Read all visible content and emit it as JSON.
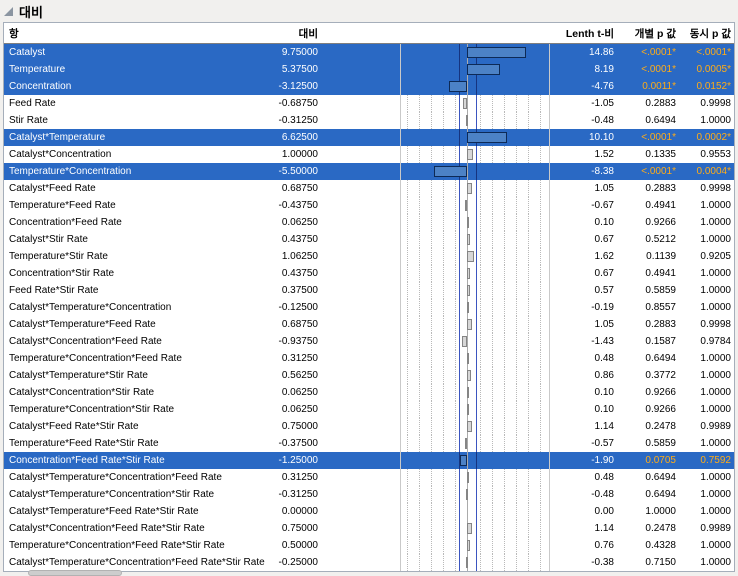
{
  "report": {
    "title": "대비"
  },
  "table": {
    "headers": {
      "term": "항",
      "contrast": "대비",
      "lenth_t": "Lenth t-비",
      "individual_p": "개별 p 값",
      "simultaneous_p": "동시 p 값"
    },
    "rows": [
      {
        "term": "Catalyst",
        "contrast": "9.75000",
        "lenth_t": "14.86",
        "p_individual": "<.0001*",
        "p_simultaneous": "<.0001*",
        "selected": true
      },
      {
        "term": "Temperature",
        "contrast": "5.37500",
        "lenth_t": "8.19",
        "p_individual": "<.0001*",
        "p_simultaneous": "0.0005*",
        "selected": true
      },
      {
        "term": "Concentration",
        "contrast": "-3.12500",
        "lenth_t": "-4.76",
        "p_individual": "0.0011*",
        "p_simultaneous": "0.0152*",
        "selected": true
      },
      {
        "term": "Feed Rate",
        "contrast": "-0.68750",
        "lenth_t": "-1.05",
        "p_individual": "0.2883",
        "p_simultaneous": "0.9998",
        "selected": false
      },
      {
        "term": "Stir Rate",
        "contrast": "-0.31250",
        "lenth_t": "-0.48",
        "p_individual": "0.6494",
        "p_simultaneous": "1.0000",
        "selected": false
      },
      {
        "term": "Catalyst*Temperature",
        "contrast": "6.62500",
        "lenth_t": "10.10",
        "p_individual": "<.0001*",
        "p_simultaneous": "0.0002*",
        "selected": true
      },
      {
        "term": "Catalyst*Concentration",
        "contrast": "1.00000",
        "lenth_t": "1.52",
        "p_individual": "0.1335",
        "p_simultaneous": "0.9553",
        "selected": false
      },
      {
        "term": "Temperature*Concentration",
        "contrast": "-5.50000",
        "lenth_t": "-8.38",
        "p_individual": "<.0001*",
        "p_simultaneous": "0.0004*",
        "selected": true
      },
      {
        "term": "Catalyst*Feed Rate",
        "contrast": "0.68750",
        "lenth_t": "1.05",
        "p_individual": "0.2883",
        "p_simultaneous": "0.9998",
        "selected": false
      },
      {
        "term": "Temperature*Feed Rate",
        "contrast": "-0.43750",
        "lenth_t": "-0.67",
        "p_individual": "0.4941",
        "p_simultaneous": "1.0000",
        "selected": false
      },
      {
        "term": "Concentration*Feed Rate",
        "contrast": "0.06250",
        "lenth_t": "0.10",
        "p_individual": "0.9266",
        "p_simultaneous": "1.0000",
        "selected": false
      },
      {
        "term": "Catalyst*Stir Rate",
        "contrast": "0.43750",
        "lenth_t": "0.67",
        "p_individual": "0.5212",
        "p_simultaneous": "1.0000",
        "selected": false
      },
      {
        "term": "Temperature*Stir Rate",
        "contrast": "1.06250",
        "lenth_t": "1.62",
        "p_individual": "0.1139",
        "p_simultaneous": "0.9205",
        "selected": false
      },
      {
        "term": "Concentration*Stir Rate",
        "contrast": "0.43750",
        "lenth_t": "0.67",
        "p_individual": "0.4941",
        "p_simultaneous": "1.0000",
        "selected": false
      },
      {
        "term": "Feed Rate*Stir Rate",
        "contrast": "0.37500",
        "lenth_t": "0.57",
        "p_individual": "0.5859",
        "p_simultaneous": "1.0000",
        "selected": false
      },
      {
        "term": "Catalyst*Temperature*Concentration",
        "contrast": "-0.12500",
        "lenth_t": "-0.19",
        "p_individual": "0.8557",
        "p_simultaneous": "1.0000",
        "selected": false
      },
      {
        "term": "Catalyst*Temperature*Feed Rate",
        "contrast": "0.68750",
        "lenth_t": "1.05",
        "p_individual": "0.2883",
        "p_simultaneous": "0.9998",
        "selected": false
      },
      {
        "term": "Catalyst*Concentration*Feed Rate",
        "contrast": "-0.93750",
        "lenth_t": "-1.43",
        "p_individual": "0.1587",
        "p_simultaneous": "0.9784",
        "selected": false
      },
      {
        "term": "Temperature*Concentration*Feed Rate",
        "contrast": "0.31250",
        "lenth_t": "0.48",
        "p_individual": "0.6494",
        "p_simultaneous": "1.0000",
        "selected": false
      },
      {
        "term": "Catalyst*Temperature*Stir Rate",
        "contrast": "0.56250",
        "lenth_t": "0.86",
        "p_individual": "0.3772",
        "p_simultaneous": "1.0000",
        "selected": false
      },
      {
        "term": "Catalyst*Concentration*Stir Rate",
        "contrast": "0.06250",
        "lenth_t": "0.10",
        "p_individual": "0.9266",
        "p_simultaneous": "1.0000",
        "selected": false
      },
      {
        "term": "Temperature*Concentration*Stir Rate",
        "contrast": "0.06250",
        "lenth_t": "0.10",
        "p_individual": "0.9266",
        "p_simultaneous": "1.0000",
        "selected": false
      },
      {
        "term": "Catalyst*Feed Rate*Stir Rate",
        "contrast": "0.75000",
        "lenth_t": "1.14",
        "p_individual": "0.2478",
        "p_simultaneous": "0.9989",
        "selected": false
      },
      {
        "term": "Temperature*Feed Rate*Stir Rate",
        "contrast": "-0.37500",
        "lenth_t": "-0.57",
        "p_individual": "0.5859",
        "p_simultaneous": "1.0000",
        "selected": false
      },
      {
        "term": "Concentration*Feed Rate*Stir Rate",
        "contrast": "-1.25000",
        "lenth_t": "-1.90",
        "p_individual": "0.0705",
        "p_simultaneous": "0.7592",
        "selected": true
      },
      {
        "term": "Catalyst*Temperature*Concentration*Feed Rate",
        "contrast": "0.31250",
        "lenth_t": "0.48",
        "p_individual": "0.6494",
        "p_simultaneous": "1.0000",
        "selected": false
      },
      {
        "term": "Catalyst*Temperature*Concentration*Stir Rate",
        "contrast": "-0.31250",
        "lenth_t": "-0.48",
        "p_individual": "0.6494",
        "p_simultaneous": "1.0000",
        "selected": false
      },
      {
        "term": "Catalyst*Temperature*Feed Rate*Stir Rate",
        "contrast": "0.00000",
        "lenth_t": "0.00",
        "p_individual": "1.0000",
        "p_simultaneous": "1.0000",
        "selected": false
      },
      {
        "term": "Catalyst*Concentration*Feed Rate*Stir Rate",
        "contrast": "0.75000",
        "lenth_t": "1.14",
        "p_individual": "0.2478",
        "p_simultaneous": "0.9989",
        "selected": false
      },
      {
        "term": "Temperature*Concentration*Feed Rate*Stir Rate",
        "contrast": "0.50000",
        "lenth_t": "0.76",
        "p_individual": "0.4328",
        "p_simultaneous": "1.0000",
        "selected": false
      },
      {
        "term": "Catalyst*Temperature*Concentration*Feed Rate*Stir Rate",
        "contrast": "-0.25000",
        "lenth_t": "-0.38",
        "p_individual": "0.7150",
        "p_simultaneous": "1.0000",
        "selected": false
      }
    ]
  },
  "chart_data": {
    "type": "bar",
    "orientation": "horizontal",
    "title": "",
    "xlabel": "",
    "ylabel": "",
    "xlim": [
      -11,
      13.5
    ],
    "gridlines": [
      -10,
      -8,
      -6,
      -4,
      -2,
      2,
      4,
      6,
      8,
      10,
      12
    ],
    "reference_lines": [
      -1.44,
      1.44
    ],
    "values": [
      9.75,
      5.375,
      -3.125,
      -0.6875,
      -0.3125,
      6.625,
      1.0,
      -5.5,
      0.6875,
      -0.4375,
      0.0625,
      0.4375,
      1.0625,
      0.4375,
      0.375,
      -0.125,
      0.6875,
      -0.9375,
      0.3125,
      0.5625,
      0.0625,
      0.0625,
      0.75,
      -0.375,
      -1.25,
      0.3125,
      -0.3125,
      0.0,
      0.75,
      0.5,
      -0.25
    ]
  },
  "colors": {
    "selected_row_background": "#2a69c4",
    "significant_p_text": "#ffac17",
    "bar_fill": "#d7d7d7",
    "bar_fill_selected": "#4c82c6",
    "reference_line": "#3b55c0"
  }
}
